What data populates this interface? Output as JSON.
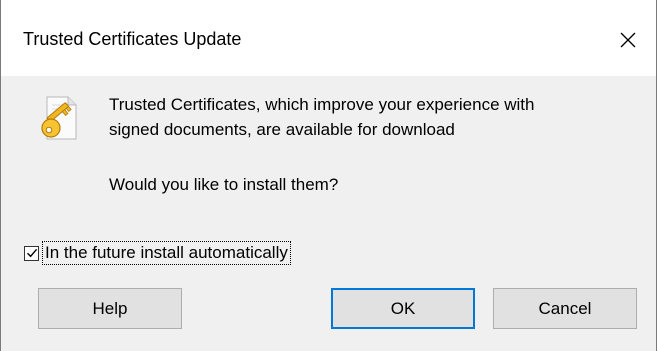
{
  "dialog": {
    "title": "Trusted Certificates Update",
    "message_line1": "Trusted Certificates, which improve your experience with",
    "message_line2": "signed documents, are available for download",
    "question": "Would you like to install them?",
    "icon": "certificate-key-icon",
    "checkbox": {
      "label": "In the future install automatically",
      "checked": true
    },
    "buttons": {
      "help": "Help",
      "ok": "OK",
      "cancel": "Cancel"
    },
    "colors": {
      "accent": "#0078d7",
      "dialog_bg": "#f0f0f0",
      "button_bg": "#e1e1e1"
    }
  }
}
